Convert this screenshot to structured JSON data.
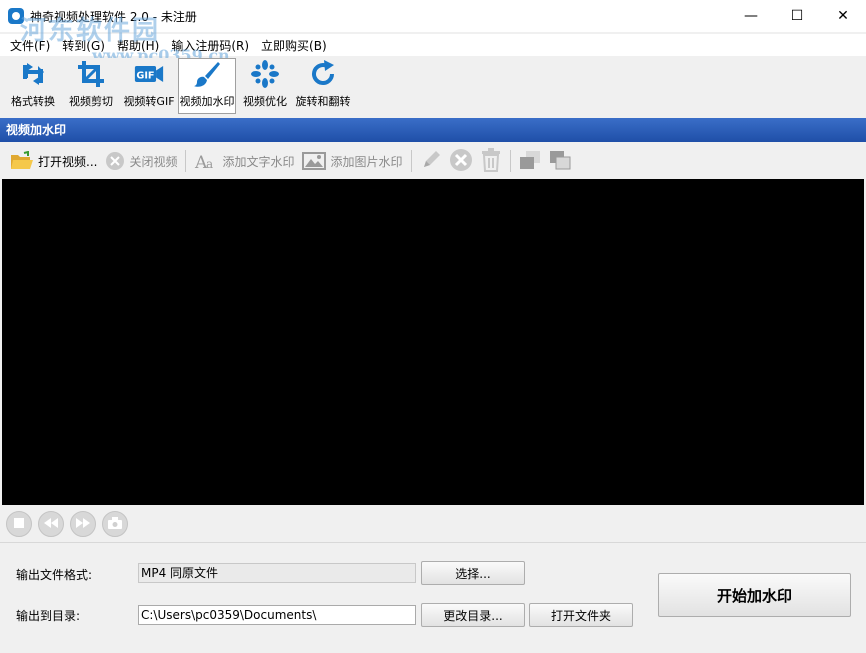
{
  "window": {
    "title": "神奇视频处理软件 2.0 - 未注册",
    "minimize_glyph": "—",
    "maximize_glyph": "☐",
    "close_glyph": "✕"
  },
  "watermark": {
    "text": "河东软件园",
    "url": "www.pc0359.cn"
  },
  "menu": {
    "items": [
      {
        "label": "文件(F)"
      },
      {
        "label": "转到(G)"
      },
      {
        "label": "帮助(H)"
      },
      {
        "label": "输入注册码(R)"
      },
      {
        "label": "立即购买(B)"
      }
    ]
  },
  "toolbar": {
    "items": [
      {
        "label": "格式转换",
        "icon": "format-convert-icon"
      },
      {
        "label": "视频剪切",
        "icon": "crop-icon"
      },
      {
        "label": "视频转GIF",
        "icon": "gif-icon"
      },
      {
        "label": "视频加水印",
        "icon": "brush-icon",
        "active": true
      },
      {
        "label": "视频优化",
        "icon": "optimize-icon"
      },
      {
        "label": "旋转和翻转",
        "icon": "rotate-icon"
      }
    ]
  },
  "section": {
    "title": "视频加水印"
  },
  "subtoolbar": {
    "open_video": "打开视频...",
    "close_video": "关闭视频",
    "add_text_watermark": "添加文字水印",
    "add_image_watermark": "添加图片水印"
  },
  "output": {
    "format_label": "输出文件格式:",
    "format_value": "MP4 同原文件",
    "select_button": "选择...",
    "dir_label": "输出到目录:",
    "dir_value": "C:\\Users\\pc0359\\Documents\\",
    "change_dir_button": "更改目录...",
    "open_folder_button": "打开文件夹",
    "start_button": "开始加水印"
  },
  "colors": {
    "accent": "#1a78c8",
    "header_bg": "#2a5cb8"
  }
}
